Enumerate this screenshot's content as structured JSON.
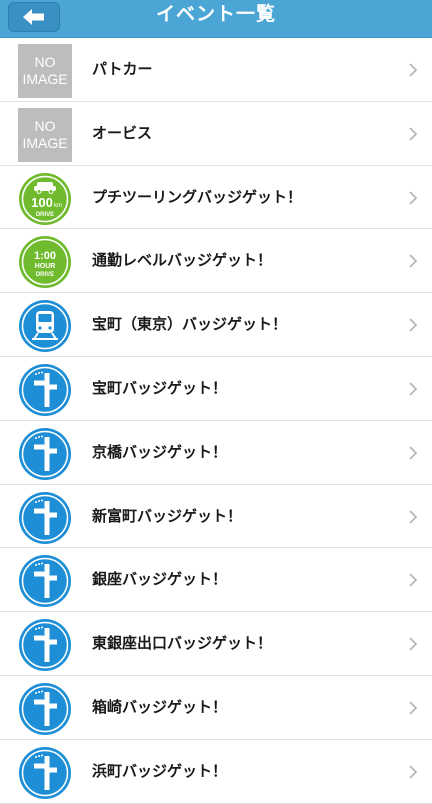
{
  "header": {
    "title": "イベント一覧",
    "back_icon": "back-arrow-icon"
  },
  "colors": {
    "navbar": "#4ba6d6",
    "badge_green": "#6fbb2d",
    "badge_blue": "#1e8fd6",
    "noimage_gray": "#bdbdbd"
  },
  "noimage": {
    "line1": "NO",
    "line2": "IMAGE"
  },
  "badge_100km": {
    "top": "100",
    "unit": "km",
    "bottom": "DRIVE"
  },
  "badge_1hour": {
    "top": "1:00",
    "mid": "HOUR",
    "bottom": "DRIVE"
  },
  "events": [
    {
      "label": "パトカー",
      "icon": "noimage"
    },
    {
      "label": "オービス",
      "icon": "noimage"
    },
    {
      "label": "プチツーリングバッジゲット！",
      "icon": "badge-100km-drive-icon"
    },
    {
      "label": "通勤レベルバッジゲット！",
      "icon": "badge-1hour-drive-icon"
    },
    {
      "label": "宝町（東京）バッジゲット！",
      "icon": "train-badge-icon"
    },
    {
      "label": "宝町バッジゲット！",
      "icon": "junction-badge-icon"
    },
    {
      "label": "京橋バッジゲット！",
      "icon": "junction-badge-icon"
    },
    {
      "label": "新富町バッジゲット！",
      "icon": "junction-badge-icon"
    },
    {
      "label": "銀座バッジゲット！",
      "icon": "junction-badge-icon"
    },
    {
      "label": "東銀座出口バッジゲット！",
      "icon": "junction-badge-icon"
    },
    {
      "label": "箱崎バッジゲット！",
      "icon": "junction-badge-icon"
    },
    {
      "label": "浜町バッジゲット！",
      "icon": "junction-badge-icon"
    }
  ]
}
